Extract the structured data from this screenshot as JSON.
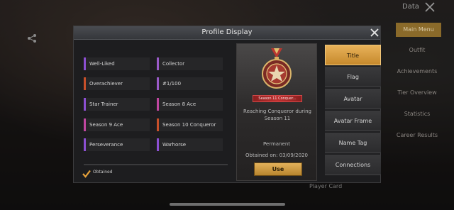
{
  "background": {
    "top_title": "Data",
    "menu_items": [
      {
        "label": "Main Menu",
        "active": true
      },
      {
        "label": "Outfit",
        "active": false
      },
      {
        "label": "Achievements",
        "active": false
      },
      {
        "label": "Tier Overview",
        "active": false
      },
      {
        "label": "Statistics",
        "active": false
      },
      {
        "label": "Career Results",
        "active": false
      }
    ],
    "player_card_label": "Player Card"
  },
  "modal": {
    "title": "Profile Display"
  },
  "titles": [
    {
      "label": "Well-Liked",
      "color": "#8c4fd2"
    },
    {
      "label": "Collector",
      "color": "#9a5ac8"
    },
    {
      "label": "Overachiever",
      "color": "#c8502a"
    },
    {
      "label": "#1/100",
      "color": "#9a5ac8"
    },
    {
      "label": "Star Trainer",
      "color": "#8c4fd2"
    },
    {
      "label": "Season 8 Ace",
      "color": "#c046a0"
    },
    {
      "label": "Season 9 Ace",
      "color": "#c046a0"
    },
    {
      "label": "Season 10 Conqueror",
      "color": "#c8502a"
    },
    {
      "label": "Perseverance",
      "color": "#8c4fd2"
    },
    {
      "label": "Warhorse",
      "color": "#8c4fd2"
    }
  ],
  "filter": {
    "obtained_label": "Obtained",
    "obtained_checked": true
  },
  "detail": {
    "badge_text": "Season 11 Conquer...",
    "description": "Reaching Conqueror during Season 11",
    "duration": "Permanent",
    "obtained_on": "Obtained on: 03/09/2020",
    "use_label": "Use"
  },
  "tabs": [
    {
      "label": "Title",
      "active": true
    },
    {
      "label": "Flag",
      "active": false
    },
    {
      "label": "Avatar",
      "active": false
    },
    {
      "label": "Avatar Frame",
      "active": false
    },
    {
      "label": "Name Tag",
      "active": false
    },
    {
      "label": "Connections",
      "active": false
    }
  ],
  "colors": {
    "accent_gold": "#d9a04a",
    "badge_red": "#c03030",
    "modal_bg": "#1d1d1f"
  }
}
